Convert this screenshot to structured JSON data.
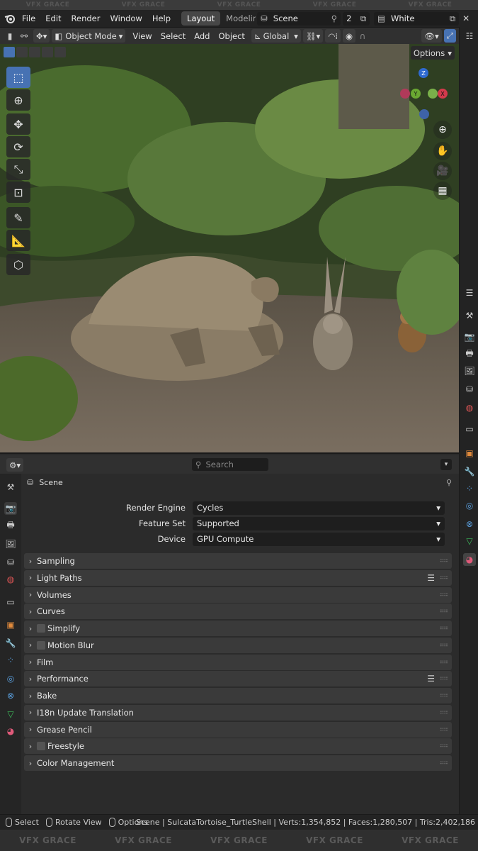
{
  "watermark": "VFX GRACE",
  "menus": [
    "File",
    "Edit",
    "Render",
    "Window",
    "Help"
  ],
  "workspace_tabs": [
    "Layout",
    "Modeling"
  ],
  "scene_name": "Scene",
  "scene_count": "2",
  "view_layer": "White",
  "header": {
    "mode": "Object Mode",
    "menus": [
      "View",
      "Select",
      "Add",
      "Object"
    ],
    "orientation": "Global",
    "options_label": "Options"
  },
  "gizmo": {
    "z": "Z",
    "y": "Y",
    "x": "X"
  },
  "properties": {
    "search_placeholder": "Search",
    "context": "Scene",
    "rows": [
      {
        "label": "Render Engine",
        "value": "Cycles"
      },
      {
        "label": "Feature Set",
        "value": "Supported"
      },
      {
        "label": "Device",
        "value": "GPU Compute"
      }
    ],
    "panels": [
      {
        "label": "Sampling",
        "checkbox": false,
        "list": false
      },
      {
        "label": "Light Paths",
        "checkbox": false,
        "list": true
      },
      {
        "label": "Volumes",
        "checkbox": false,
        "list": false
      },
      {
        "label": "Curves",
        "checkbox": false,
        "list": false
      },
      {
        "label": "Simplify",
        "checkbox": true,
        "list": false
      },
      {
        "label": "Motion Blur",
        "checkbox": true,
        "list": false
      },
      {
        "label": "Film",
        "checkbox": false,
        "list": false
      },
      {
        "label": "Performance",
        "checkbox": false,
        "list": true
      },
      {
        "label": "Bake",
        "checkbox": false,
        "list": false
      },
      {
        "label": "I18n Update Translation",
        "checkbox": false,
        "list": false
      },
      {
        "label": "Grease Pencil",
        "checkbox": false,
        "list": false
      },
      {
        "label": "Freestyle",
        "checkbox": true,
        "list": false
      },
      {
        "label": "Color Management",
        "checkbox": false,
        "list": false
      }
    ]
  },
  "status": {
    "hints": [
      "Select",
      "Rotate View",
      "Options"
    ],
    "info": "Scene | SulcataTortoise_TurtleShell | Verts:1,354,852 | Faces:1,280,507 | Tris:2,402,186"
  },
  "colors": {
    "accent": "#4772b3",
    "panel": "#3a3a3a",
    "background": "#2b2b2b"
  }
}
